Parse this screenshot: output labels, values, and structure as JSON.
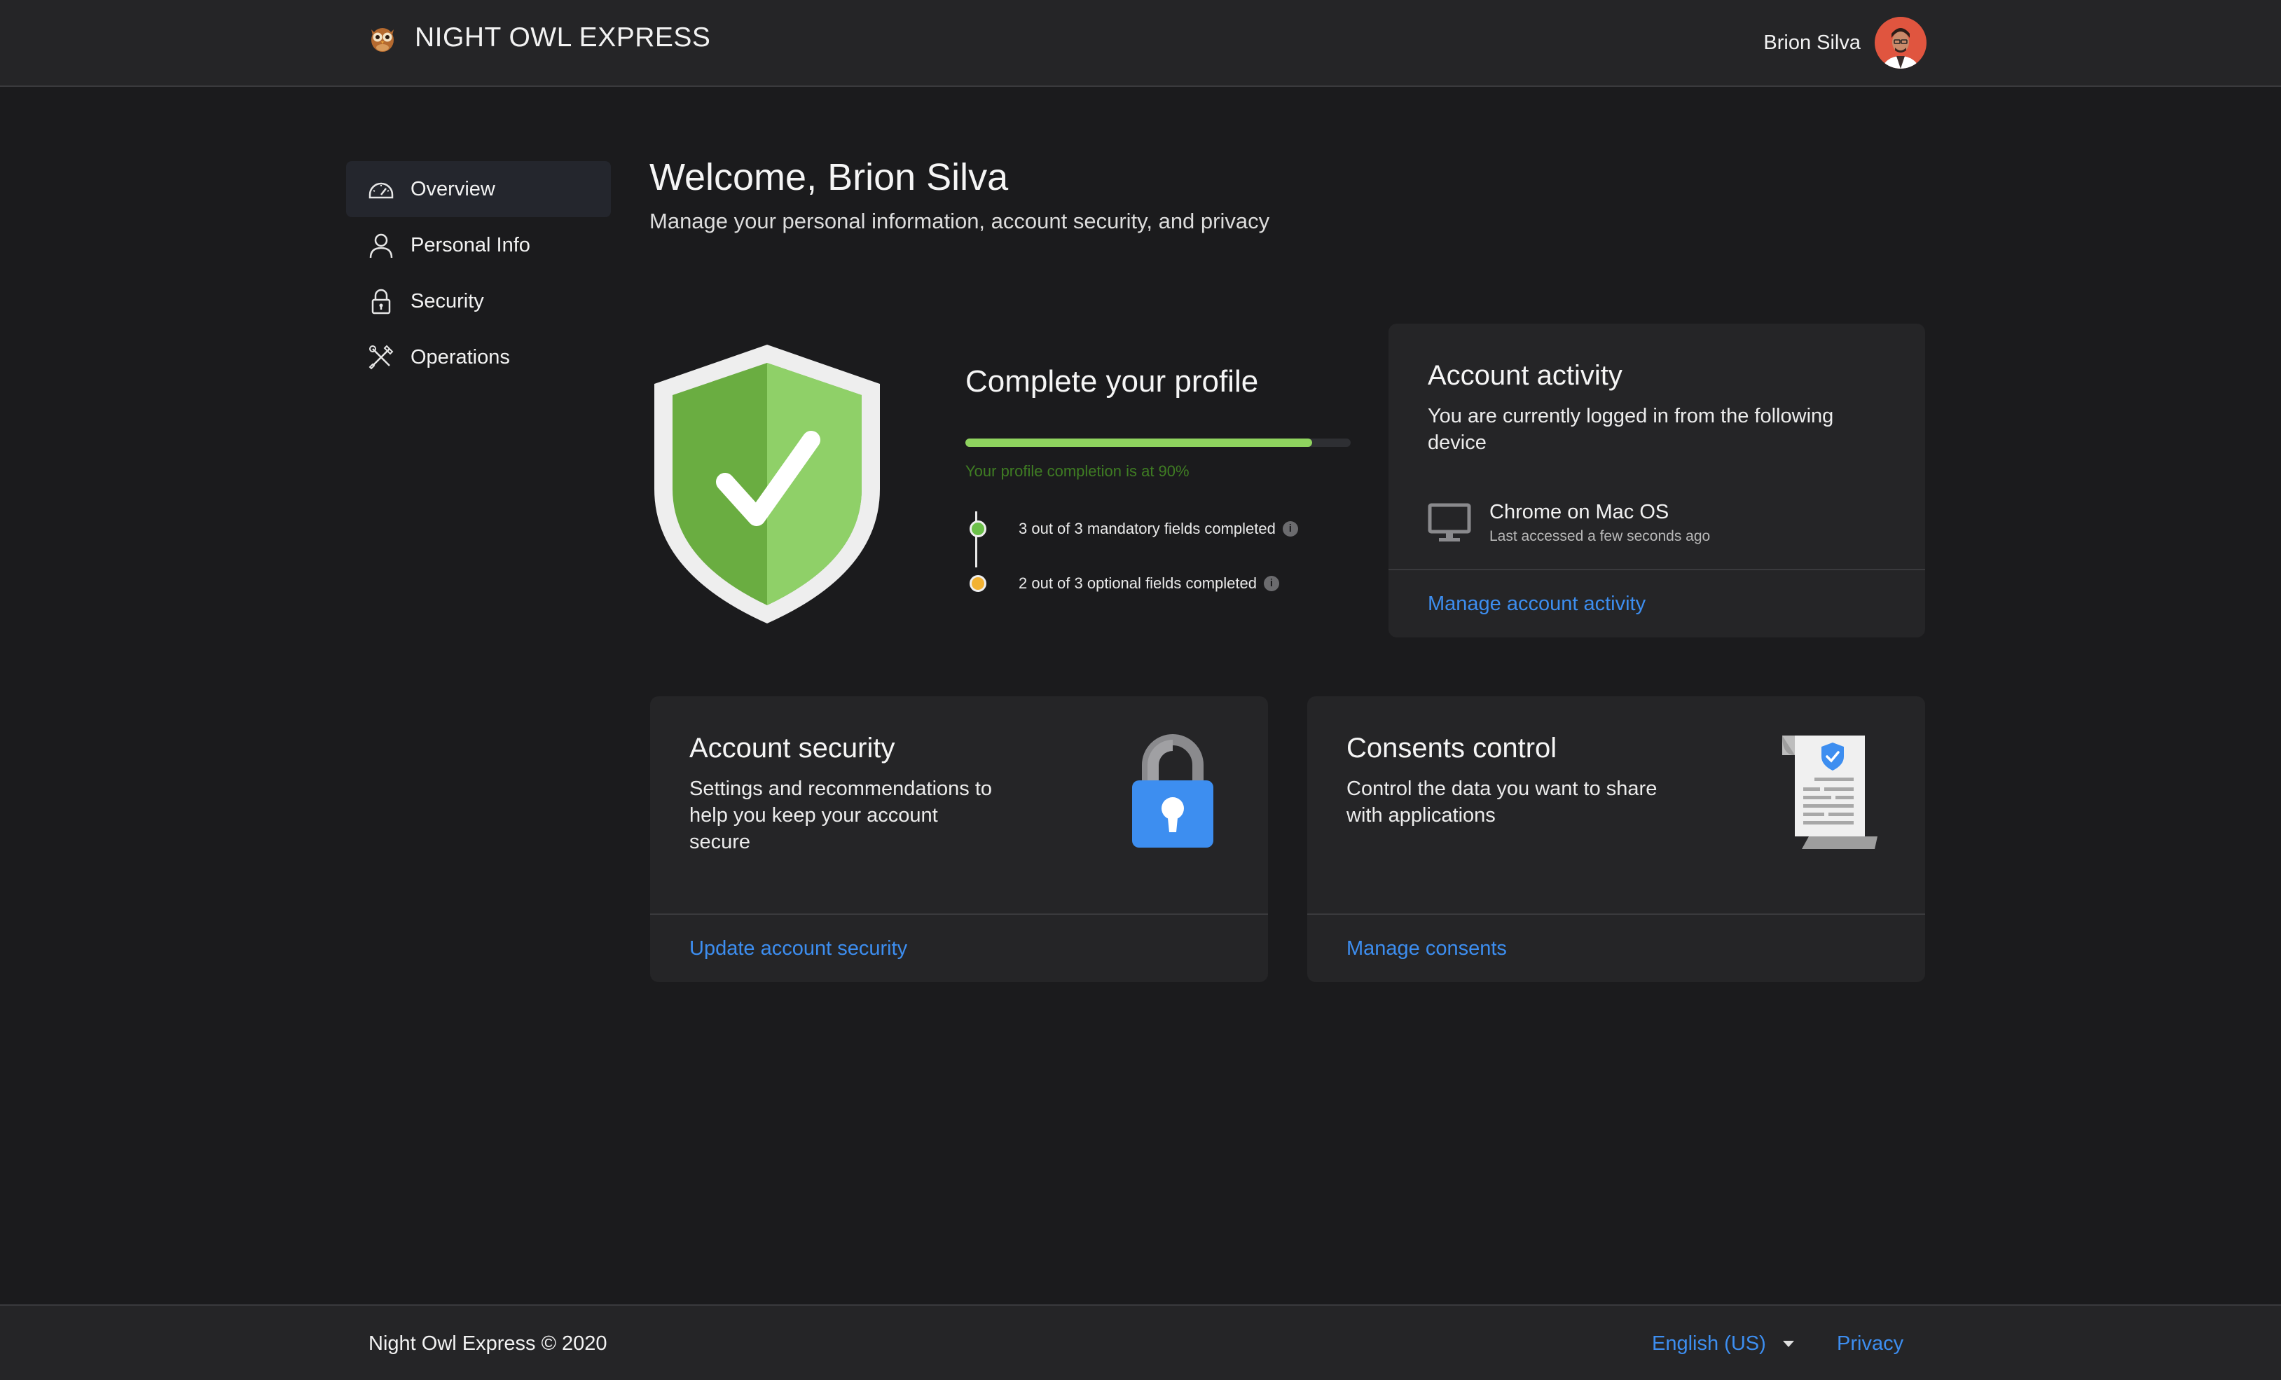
{
  "header": {
    "brand": "NIGHT OWL EXPRESS",
    "user_name": "Brion Silva"
  },
  "sidebar": {
    "items": [
      {
        "label": "Overview",
        "icon": "speedometer-icon",
        "active": true
      },
      {
        "label": "Personal Info",
        "icon": "user-icon",
        "active": false
      },
      {
        "label": "Security",
        "icon": "lock-icon",
        "active": false
      },
      {
        "label": "Operations",
        "icon": "tools-icon",
        "active": false
      }
    ]
  },
  "welcome": {
    "title": "Welcome, Brion Silva",
    "subtitle": "Manage your personal information, account security, and privacy"
  },
  "profile": {
    "title": "Complete your profile",
    "completion": 0.9,
    "completion_text": "Your profile completion is at 90%",
    "checks": [
      {
        "text": "3 out of 3 mandatory fields completed",
        "status_color": "#6cc04a"
      },
      {
        "text": "2 out of 3 optional fields completed",
        "status_color": "#f2b233"
      }
    ]
  },
  "activity": {
    "title": "Account activity",
    "description": "You are currently logged in from the following device",
    "device_name": "Chrome on Mac OS",
    "device_sub": "Last accessed a few seconds ago",
    "link": "Manage account activity"
  },
  "security": {
    "title": "Account security",
    "description": "Settings and recommendations to help you keep your account secure",
    "link": "Update account security"
  },
  "consents": {
    "title": "Consents control",
    "description": "Control the data you want to share with applications",
    "link": "Manage consents"
  },
  "footer": {
    "copyright": "Night Owl Express © 2020",
    "language": "English (US)",
    "privacy": "Privacy"
  },
  "colors": {
    "accent_link": "#3d8ef0",
    "progress": "#8fd35f",
    "background": "#1b1b1d",
    "surface": "#252527"
  }
}
